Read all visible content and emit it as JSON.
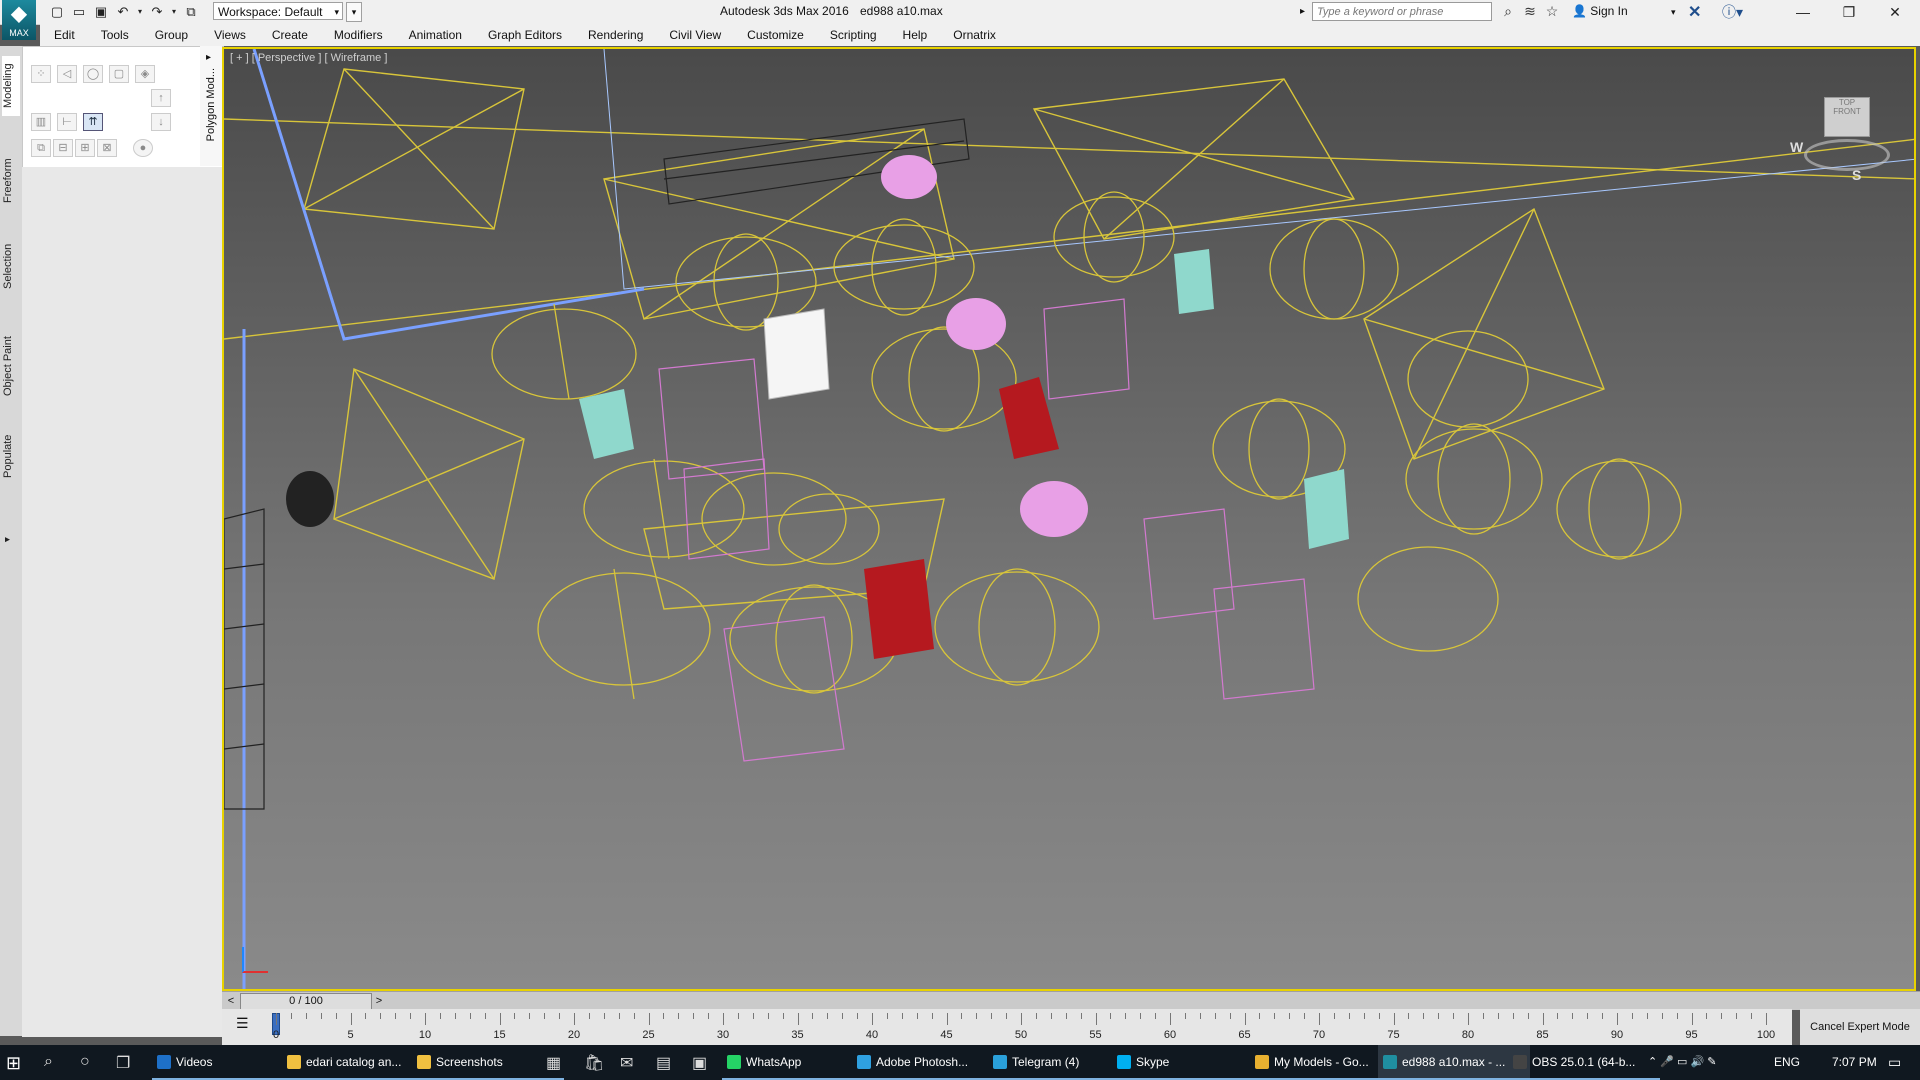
{
  "app": {
    "title": "Autodesk 3ds Max 2016",
    "file": "ed988 a10.max",
    "logo_label": "MAX",
    "workspace": "Workspace: Default",
    "search_placeholder": "Type a keyword or phrase",
    "sign_in": "Sign In"
  },
  "menu": [
    "Edit",
    "Tools",
    "Group",
    "Views",
    "Create",
    "Modifiers",
    "Animation",
    "Graph Editors",
    "Rendering",
    "Civil View",
    "Customize",
    "Scripting",
    "Help",
    "Ornatrix"
  ],
  "side_tabs": [
    "Modeling",
    "Freeform",
    "Selection",
    "Object Paint",
    "Populate"
  ],
  "ribbon": {
    "panel_label": "Polygon Mod..."
  },
  "viewport": {
    "label": "[ + ] [ Perspective ] [ Wireframe ]",
    "viewcube": {
      "top": "TOP",
      "front": "FRONT",
      "west": "W",
      "south": "S"
    }
  },
  "timeline": {
    "slider": "0 / 100",
    "prev": "<",
    "next": ">"
  },
  "ruler": {
    "ticks": [
      0,
      5,
      10,
      15,
      20,
      25,
      30,
      35,
      40,
      45,
      50,
      55,
      60,
      65,
      70,
      75,
      80,
      85,
      90,
      95,
      100
    ]
  },
  "status": {
    "cancel_expert": "Cancel Expert Mode"
  },
  "taskbar": {
    "apps": [
      {
        "label": "Videos",
        "color": "#1e70c8"
      },
      {
        "label": "edari catalog an...",
        "color": "#f0c040"
      },
      {
        "label": "Screenshots",
        "color": "#f0c040"
      },
      {
        "label": "WhatsApp",
        "color": "#25d366"
      },
      {
        "label": "Adobe Photosh...",
        "color": "#2fa0e0"
      },
      {
        "label": "Telegram (4)",
        "color": "#2aa0da"
      },
      {
        "label": "Skype",
        "color": "#00aff0"
      },
      {
        "label": "My Models - Go...",
        "color": "#e8b030"
      },
      {
        "label": "ed988 a10.max - ...",
        "color": "#1f8fa0"
      },
      {
        "label": "OBS 25.0.1 (64-b...",
        "color": "#444444"
      }
    ],
    "lang": "ENG",
    "time": "7:07 PM"
  }
}
